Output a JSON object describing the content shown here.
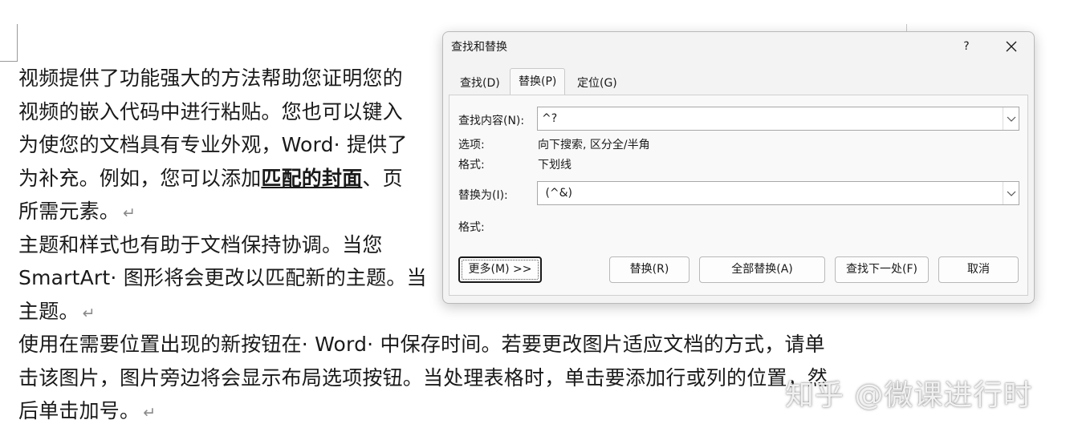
{
  "document": {
    "lines": [
      "视频提供了功能强大的方法帮助您证明您的",
      "视频的嵌入代码中进行粘贴。您也可以键入",
      "为使您的文档具有专业外观，Word· 提供了",
      "为补充。例如，您可以添加",
      "所需元素。",
      "主题和样式也有助于文档保持协调。当您",
      "SmartArt· 图形将会更改以匹配新的主题。当",
      "主题。",
      "使用在需要位置出现的新按钮在· Word· 中保存时间。若要更改图片适应文档的方式，请单",
      "击该图片，图片旁边将会显示布局选项按钮。当处理表格时，单击要添加行或列的位置，然",
      "后单击加号。"
    ],
    "line4_bold": "匹配的封面",
    "line4_tail": "、页",
    "para_mark": "↵",
    "watermark": "知乎 @微课进行时"
  },
  "dialog": {
    "title": "查找和替换",
    "help_label": "?",
    "tabs": [
      {
        "label": "查找(D)",
        "active": false
      },
      {
        "label": "替换(P)",
        "active": true
      },
      {
        "label": "定位(G)",
        "active": false
      }
    ],
    "find_label": "查找内容(N):",
    "find_value": "^?",
    "options_label": "选项:",
    "options_value": "向下搜索, 区分全/半角",
    "format_label": "格式:",
    "format_value": "下划线",
    "replace_label": "替换为(I):",
    "replace_value": " (^&)",
    "replace_format_label": "格式:",
    "buttons": {
      "more": "更多(M) >>",
      "replace": "替换(R)",
      "replace_all": "全部替换(A)",
      "find_next": "查找下一处(F)",
      "cancel": "取消"
    }
  }
}
